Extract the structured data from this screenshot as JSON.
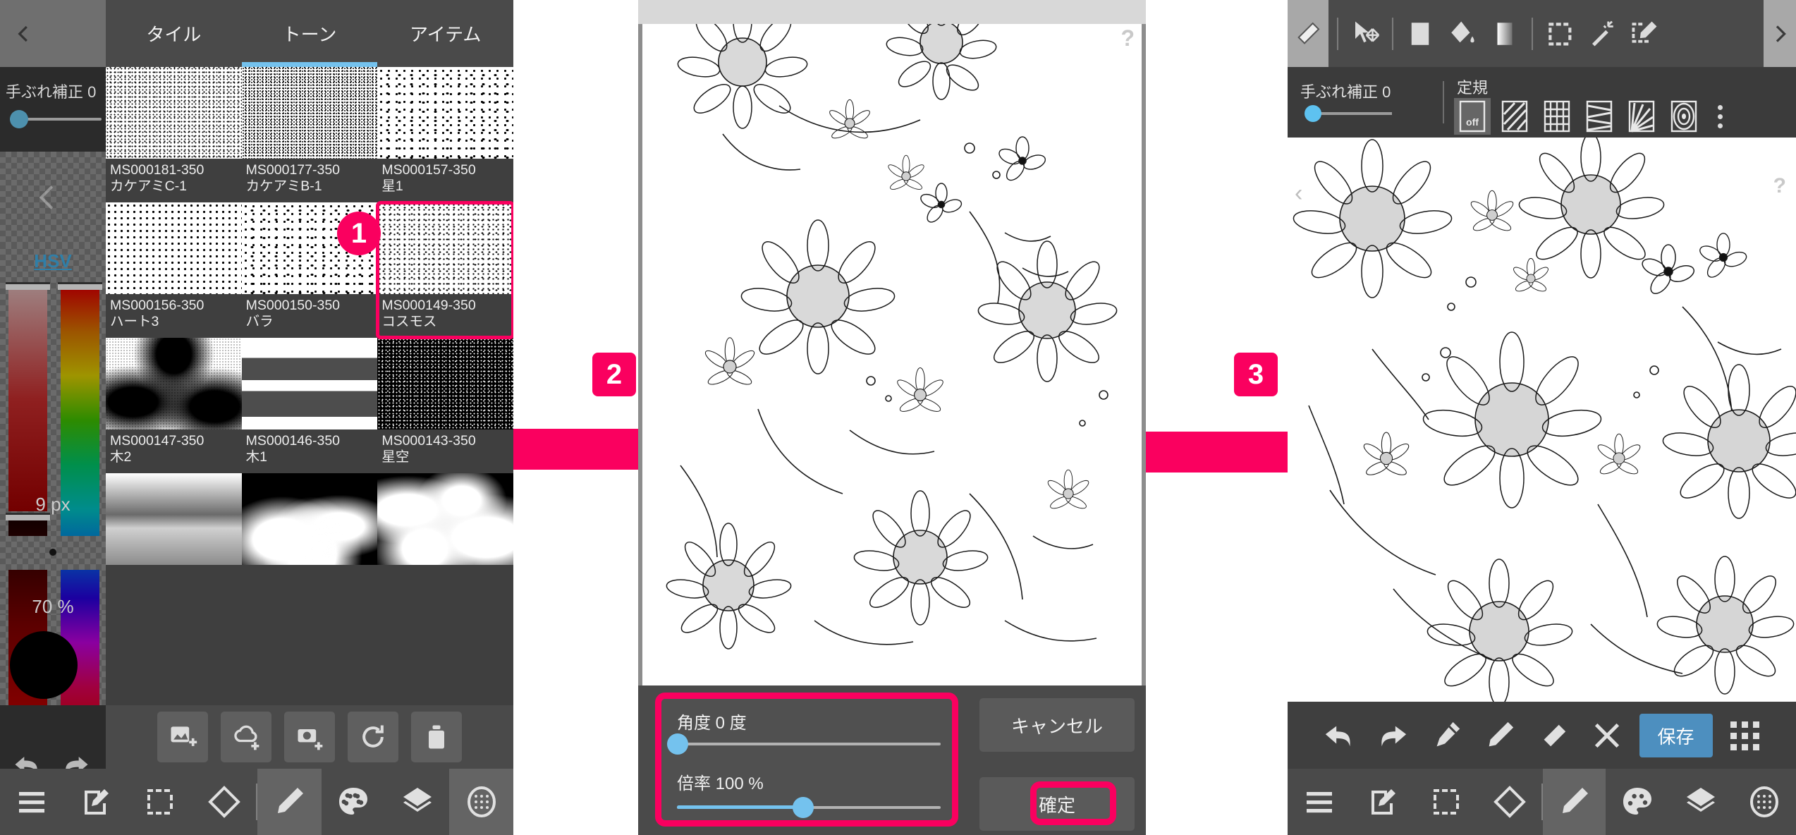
{
  "panel1": {
    "side": {
      "back_icon": "chevron-left-icon",
      "stabilizer_label": "手ぶれ補正 0",
      "hsv_label": "HSV",
      "brush_size": "9 px",
      "opacity": "70 %",
      "collapse_icon": "chevron-left-icon",
      "undo_icon": "undo-icon",
      "redo_icon": "redo-icon"
    },
    "tabs": [
      {
        "label": "タイル",
        "active": false
      },
      {
        "label": "トーン",
        "active": true
      },
      {
        "label": "アイテム",
        "active": false
      }
    ],
    "tones": [
      {
        "code": "MS000181-350",
        "name": "カケアミC-1",
        "pattern": "p-noiseA",
        "selected": false
      },
      {
        "code": "MS000177-350",
        "name": "カケアミB-1",
        "pattern": "p-noiseB",
        "selected": false
      },
      {
        "code": "MS000157-350",
        "name": "星1",
        "pattern": "p-sparse2",
        "selected": false
      },
      {
        "code": "MS000156-350",
        "name": "ハート3",
        "pattern": "p-sparse",
        "selected": false
      },
      {
        "code": "MS000150-350",
        "name": "バラ",
        "pattern": "p-sparse2",
        "selected": false
      },
      {
        "code": "MS000149-350",
        "name": "コスモス",
        "pattern": "p-cosmos",
        "selected": true
      },
      {
        "code": "MS000147-350",
        "name": "木2",
        "pattern": "p-tree2",
        "selected": false
      },
      {
        "code": "MS000146-350",
        "name": "木1",
        "pattern": "p-tree1",
        "selected": false
      },
      {
        "code": "MS000143-350",
        "name": "星空",
        "pattern": "p-starsky",
        "selected": false
      },
      {
        "code": "",
        "name": "",
        "pattern": "p-grad",
        "selected": false
      },
      {
        "code": "",
        "name": "",
        "pattern": "p-cloud1",
        "selected": false
      },
      {
        "code": "",
        "name": "",
        "pattern": "p-cloud2",
        "selected": false
      }
    ],
    "actions": [
      {
        "icon": "add-image-icon"
      },
      {
        "icon": "add-cloud-icon"
      },
      {
        "icon": "add-camera-icon"
      },
      {
        "icon": "refresh-icon"
      },
      {
        "icon": "trash-icon"
      }
    ],
    "bottom_nav": [
      {
        "icon": "menu-icon",
        "selected": false
      },
      {
        "icon": "edit-icon",
        "selected": false
      },
      {
        "icon": "select-icon",
        "selected": false
      },
      {
        "icon": "rotate-icon",
        "selected": false
      },
      {
        "icon": "pencil-icon",
        "selected": true
      },
      {
        "icon": "palette-icon",
        "selected": false
      },
      {
        "icon": "layers-icon",
        "selected": false
      },
      {
        "icon": "tone-icon",
        "selected": true
      }
    ]
  },
  "panel2": {
    "help_icon": "?",
    "dialog": {
      "angle_label": "角度 0 度",
      "angle_value": 0,
      "angle_percent": 0,
      "scale_label": "倍率 100 %",
      "scale_value": 100,
      "scale_percent": 50,
      "cancel_label": "キャンセル",
      "confirm_label": "確定"
    }
  },
  "panel3": {
    "toolbar": {
      "left_icon": "eraser-slanted-icon",
      "items": [
        {
          "icon": "move-select-icon"
        },
        {
          "icon": "fill-square-icon"
        },
        {
          "icon": "bucket-icon"
        },
        {
          "icon": "gradient-icon"
        },
        {
          "icon": "marquee-icon"
        },
        {
          "icon": "magic-wand-icon"
        },
        {
          "icon": "lasso-edit-icon"
        }
      ],
      "right_icon": "chevron-right-icon"
    },
    "options": {
      "stabilizer_label": "手ぶれ補正 0",
      "ruler_label": "定規",
      "ruler_buttons": [
        {
          "icon": "ruler-off-icon",
          "label": "off",
          "active": true
        },
        {
          "icon": "ruler-parallel-icon",
          "label": "",
          "active": false
        },
        {
          "icon": "ruler-grid-icon",
          "label": "",
          "active": false
        },
        {
          "icon": "ruler-perspective-icon",
          "label": "",
          "active": false
        },
        {
          "icon": "ruler-radial-icon",
          "label": "",
          "active": false
        },
        {
          "icon": "ruler-concentric-icon",
          "label": "",
          "active": false
        }
      ],
      "more_icon": "kebab-icon"
    },
    "canvas": {
      "left_arrow_icon": "chevron-left-icon",
      "help_icon": "?"
    },
    "edit_bar": [
      {
        "icon": "undo-icon",
        "label": ""
      },
      {
        "icon": "redo-icon",
        "label": ""
      },
      {
        "icon": "pen-icon",
        "label": ""
      },
      {
        "icon": "pencil-icon",
        "label": ""
      },
      {
        "icon": "eraser-icon",
        "label": ""
      },
      {
        "icon": "close-icon",
        "label": ""
      },
      {
        "icon": "save-button",
        "label": "保存"
      },
      {
        "icon": "grid-dots-icon",
        "label": ""
      }
    ],
    "bottom_nav": [
      {
        "icon": "menu-icon",
        "selected": false
      },
      {
        "icon": "edit-icon",
        "selected": false
      },
      {
        "icon": "select-icon",
        "selected": false
      },
      {
        "icon": "rotate-icon",
        "selected": false
      },
      {
        "icon": "pencil-icon",
        "selected": true
      },
      {
        "icon": "palette-icon",
        "selected": false
      },
      {
        "icon": "layers-icon",
        "selected": false
      },
      {
        "icon": "tone-icon",
        "selected": false
      }
    ]
  },
  "steps": [
    {
      "number": "1"
    },
    {
      "number": "2"
    },
    {
      "number": "3"
    }
  ],
  "colors": {
    "accent_pink": "#fa005f",
    "accent_blue": "#74c2ee",
    "panel_bg": "#4a4a4a",
    "save_blue": "#4d8fbf"
  }
}
